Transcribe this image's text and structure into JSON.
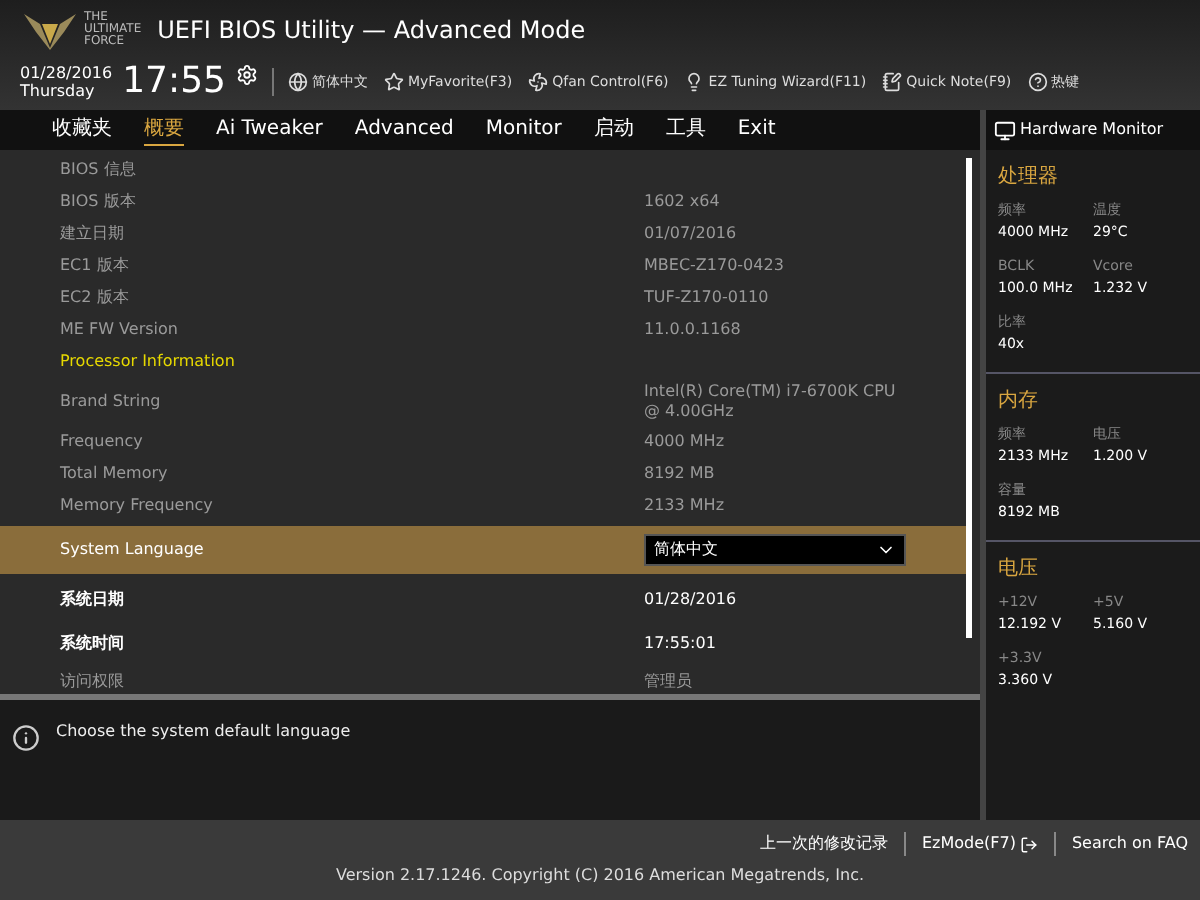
{
  "header": {
    "logo_lines": [
      "THE",
      "ULTIMATE",
      "FORCE"
    ],
    "title": "UEFI BIOS Utility — Advanced Mode",
    "date": "01/28/2016",
    "day": "Thursday",
    "time": "17:55"
  },
  "toolbar": [
    {
      "kind": "globe",
      "label": "简体中文"
    },
    {
      "kind": "favorite",
      "label": "MyFavorite(F3)"
    },
    {
      "kind": "fan",
      "label": "Qfan Control(F6)"
    },
    {
      "kind": "bulb",
      "label": "EZ Tuning Wizard(F11)"
    },
    {
      "kind": "note",
      "label": "Quick Note(F9)"
    },
    {
      "kind": "help",
      "label": "热键"
    }
  ],
  "tabs": [
    {
      "label": "收藏夹",
      "selected": false
    },
    {
      "label": "概要",
      "selected": true
    },
    {
      "label": "Ai Tweaker",
      "selected": false
    },
    {
      "label": "Advanced",
      "selected": false
    },
    {
      "label": "Monitor",
      "selected": false
    },
    {
      "label": "启动",
      "selected": false
    },
    {
      "label": "工具",
      "selected": false
    },
    {
      "label": "Exit",
      "selected": false
    }
  ],
  "rows": [
    {
      "kind": "info",
      "label": "BIOS 信息",
      "selected": false
    },
    {
      "kind": "info",
      "label": "BIOS 版本",
      "value": "1602 x64",
      "selected": false
    },
    {
      "kind": "info",
      "label": "建立日期",
      "value": "01/07/2016",
      "selected": false
    },
    {
      "kind": "info",
      "label": "EC1 版本",
      "value": "MBEC-Z170-0423",
      "selected": false
    },
    {
      "kind": "info",
      "label": "EC2 版本",
      "value": "TUF-Z170-0110",
      "selected": false
    },
    {
      "kind": "info",
      "label": "ME FW Version",
      "value": "11.0.0.1168",
      "selected": false
    },
    {
      "kind": "heading",
      "label": "Processor Information",
      "selected": false
    },
    {
      "kind": "info",
      "label": "Brand String",
      "value": "Intel(R) Core(TM) i7-6700K CPU @ 4.00GHz",
      "selected": false
    },
    {
      "kind": "info",
      "label": "Frequency",
      "value": "4000 MHz",
      "selected": false
    },
    {
      "kind": "info",
      "label": "Total Memory",
      "value": "8192 MB",
      "selected": false
    },
    {
      "kind": "info",
      "label": "Memory Frequency",
      "value": "2133 MHz",
      "selected": false
    },
    {
      "kind": "dropdown",
      "label": "System Language",
      "value": "简体中文",
      "selected": true
    },
    {
      "kind": "setting",
      "label": "系统日期",
      "value": "01/28/2016",
      "selected": false
    },
    {
      "kind": "setting",
      "label": "系统时间",
      "value": "17:55:01",
      "selected": false
    },
    {
      "kind": "info",
      "label": "访问权限",
      "value": "管理员",
      "selected": false
    }
  ],
  "help_text": "Choose the system default language",
  "hardware_monitor": {
    "title": "Hardware Monitor",
    "sections": [
      {
        "title": "处理器",
        "fields": [
          {
            "label": "频率",
            "value": "4000 MHz"
          },
          {
            "label": "温度",
            "value": "29°C"
          },
          {
            "label": "BCLK",
            "value": "100.0 MHz"
          },
          {
            "label": "Vcore",
            "value": "1.232 V"
          },
          {
            "label": "比率",
            "value": "40x"
          }
        ]
      },
      {
        "title": "内存",
        "fields": [
          {
            "label": "频率",
            "value": "2133 MHz"
          },
          {
            "label": "电压",
            "value": "1.200 V"
          },
          {
            "label": "容量",
            "value": "8192 MB"
          }
        ]
      },
      {
        "title": "电压",
        "fields": [
          {
            "label": "+12V",
            "value": "12.192 V"
          },
          {
            "label": "+5V",
            "value": "5.160 V"
          },
          {
            "label": "+3.3V",
            "value": "3.360 V"
          }
        ]
      }
    ]
  },
  "footer": {
    "links": [
      {
        "kind": "plain",
        "label": "上一次的修改记录"
      },
      {
        "kind": "exit",
        "label": "EzMode(F7)"
      },
      {
        "kind": "plain",
        "label": "Search on FAQ"
      }
    ],
    "version": "Version 2.17.1246. Copyright (C) 2016 American Megatrends, Inc."
  }
}
